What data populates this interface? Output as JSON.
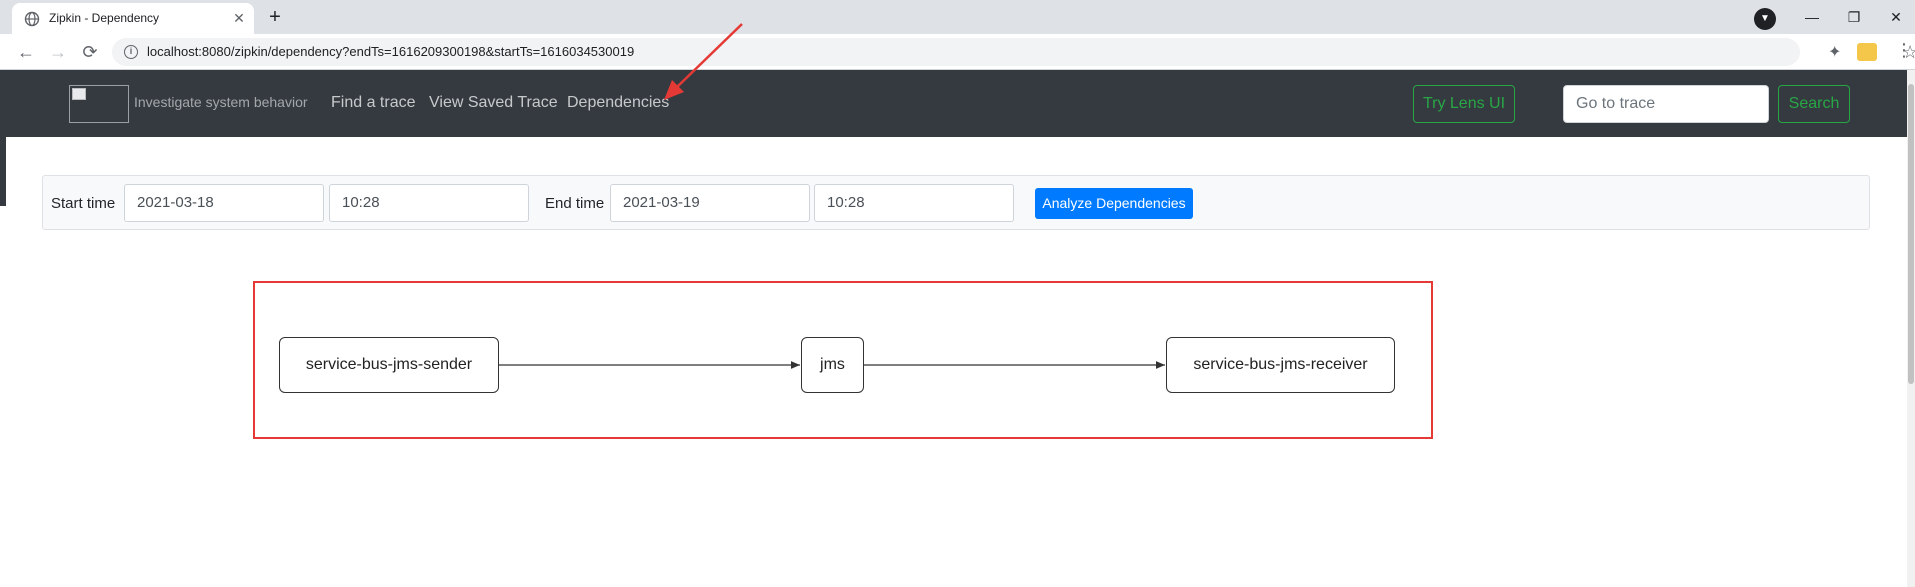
{
  "browser": {
    "tab_title": "Zipkin - Dependency",
    "tab_close": "✕",
    "new_tab": "+",
    "url": "localhost:8080/zipkin/dependency?endTs=1616209300198&startTs=1616034530019",
    "window_controls": {
      "minimize": "—",
      "restore": "❐",
      "close": "✕"
    },
    "nav": {
      "back": "←",
      "forward": "→",
      "reload": "⟳"
    },
    "icons": [
      "globe-icon",
      "info-icon",
      "star-icon",
      "extensions-icon",
      "profile-icon",
      "menu-icon"
    ]
  },
  "navbar": {
    "brand_text": "Investigate system behavior",
    "links": [
      "Find a trace",
      "View Saved Trace",
      "Dependencies"
    ],
    "lens_button": "Try Lens UI",
    "trace_placeholder": "Go to trace",
    "search_button": "Search"
  },
  "form": {
    "start_label": "Start time",
    "start_date": "2021-03-18",
    "start_time": "10:28",
    "end_label": "End time",
    "end_date": "2021-03-19",
    "end_time": "10:28",
    "analyze_button": "Analyze Dependencies"
  },
  "graph": {
    "nodes": [
      "service-bus-jms-sender",
      "jms",
      "service-bus-jms-receiver"
    ],
    "edges": [
      [
        "service-bus-jms-sender",
        "jms"
      ],
      [
        "jms",
        "service-bus-jms-receiver"
      ]
    ]
  },
  "colors": {
    "navbar_bg": "#343a40",
    "success": "#28a745",
    "primary": "#007bff",
    "annotation_red": "#e53935"
  }
}
